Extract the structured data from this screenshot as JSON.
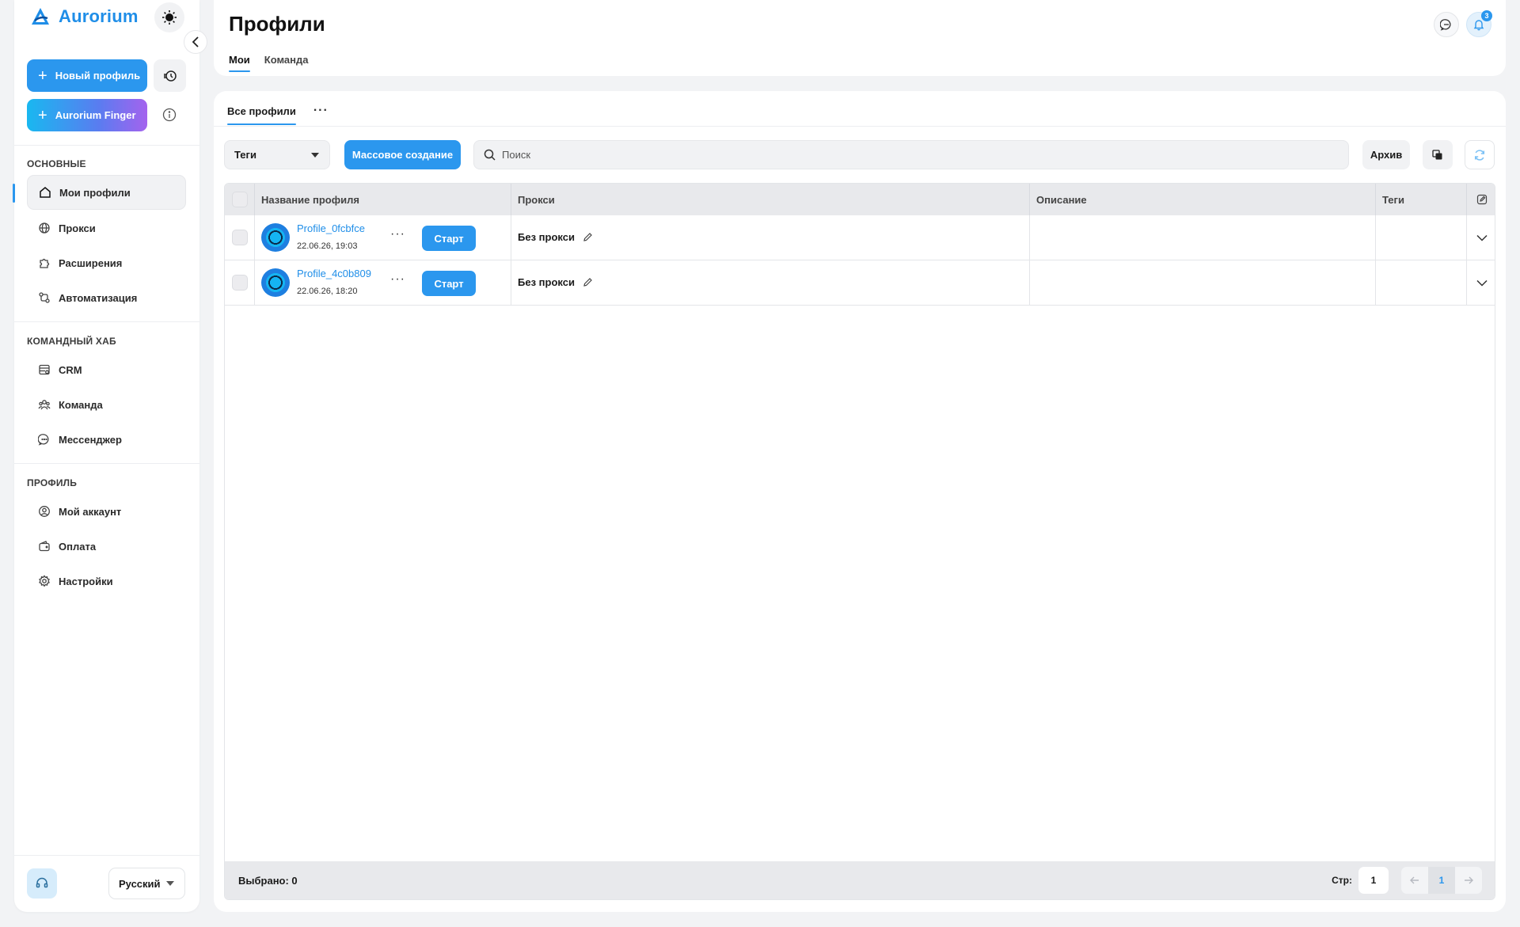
{
  "app": {
    "name": "Aurorium"
  },
  "colors": {
    "accent": "#2b97ee",
    "finger_gradient": [
      "#19b8f0",
      "#a463ee"
    ],
    "link": "#1f8ee8"
  },
  "sidebar": {
    "new_profile_label": "Новый профиль",
    "finger_label": "Aurorium Finger",
    "sections": [
      {
        "title": "ОСНОВНЫЕ",
        "items": [
          {
            "label": "Мои профили",
            "icon": "home-icon",
            "active": true
          },
          {
            "label": "Прокси",
            "icon": "globe-icon"
          },
          {
            "label": "Расширения",
            "icon": "puzzle-icon"
          },
          {
            "label": "Автоматизация",
            "icon": "automation-icon"
          }
        ]
      },
      {
        "title": "КОМАНДНЫЙ ХАБ",
        "items": [
          {
            "label": "CRM",
            "icon": "crm-icon"
          },
          {
            "label": "Команда",
            "icon": "team-icon"
          },
          {
            "label": "Мессенджер",
            "icon": "chat-icon"
          }
        ]
      },
      {
        "title": "ПРОФИЛЬ",
        "items": [
          {
            "label": "Мой аккаунт",
            "icon": "user-circle-icon"
          },
          {
            "label": "Оплата",
            "icon": "wallet-icon"
          },
          {
            "label": "Настройки",
            "icon": "gear-icon"
          }
        ]
      }
    ],
    "language": "Русский"
  },
  "header": {
    "title": "Профили",
    "tabs": [
      {
        "label": "Мои",
        "active": true
      },
      {
        "label": "Команда"
      }
    ],
    "notifications_count": "3"
  },
  "main": {
    "sub_tabs": [
      {
        "label": "Все профили",
        "active": true
      }
    ],
    "toolbar": {
      "tags_label": "Теги",
      "bulk_create_label": "Массовое создание",
      "search_placeholder": "Поиск",
      "archive_label": "Архив"
    },
    "table": {
      "columns": [
        "Название профиля",
        "Прокси",
        "Описание",
        "Теги"
      ],
      "rows": [
        {
          "name": "Profile_0fcbfce",
          "date": "22.06.26, 19:03",
          "start_label": "Старт",
          "proxy": "Без прокси",
          "description": "",
          "tags": ""
        },
        {
          "name": "Profile_4c0b809",
          "date": "22.06.26, 18:20",
          "start_label": "Старт",
          "proxy": "Без прокси",
          "description": "",
          "tags": ""
        }
      ]
    },
    "footer": {
      "selected_label": "Выбрано: 0",
      "page_label": "Стр:",
      "page_input": "1",
      "current_page": "1"
    }
  }
}
